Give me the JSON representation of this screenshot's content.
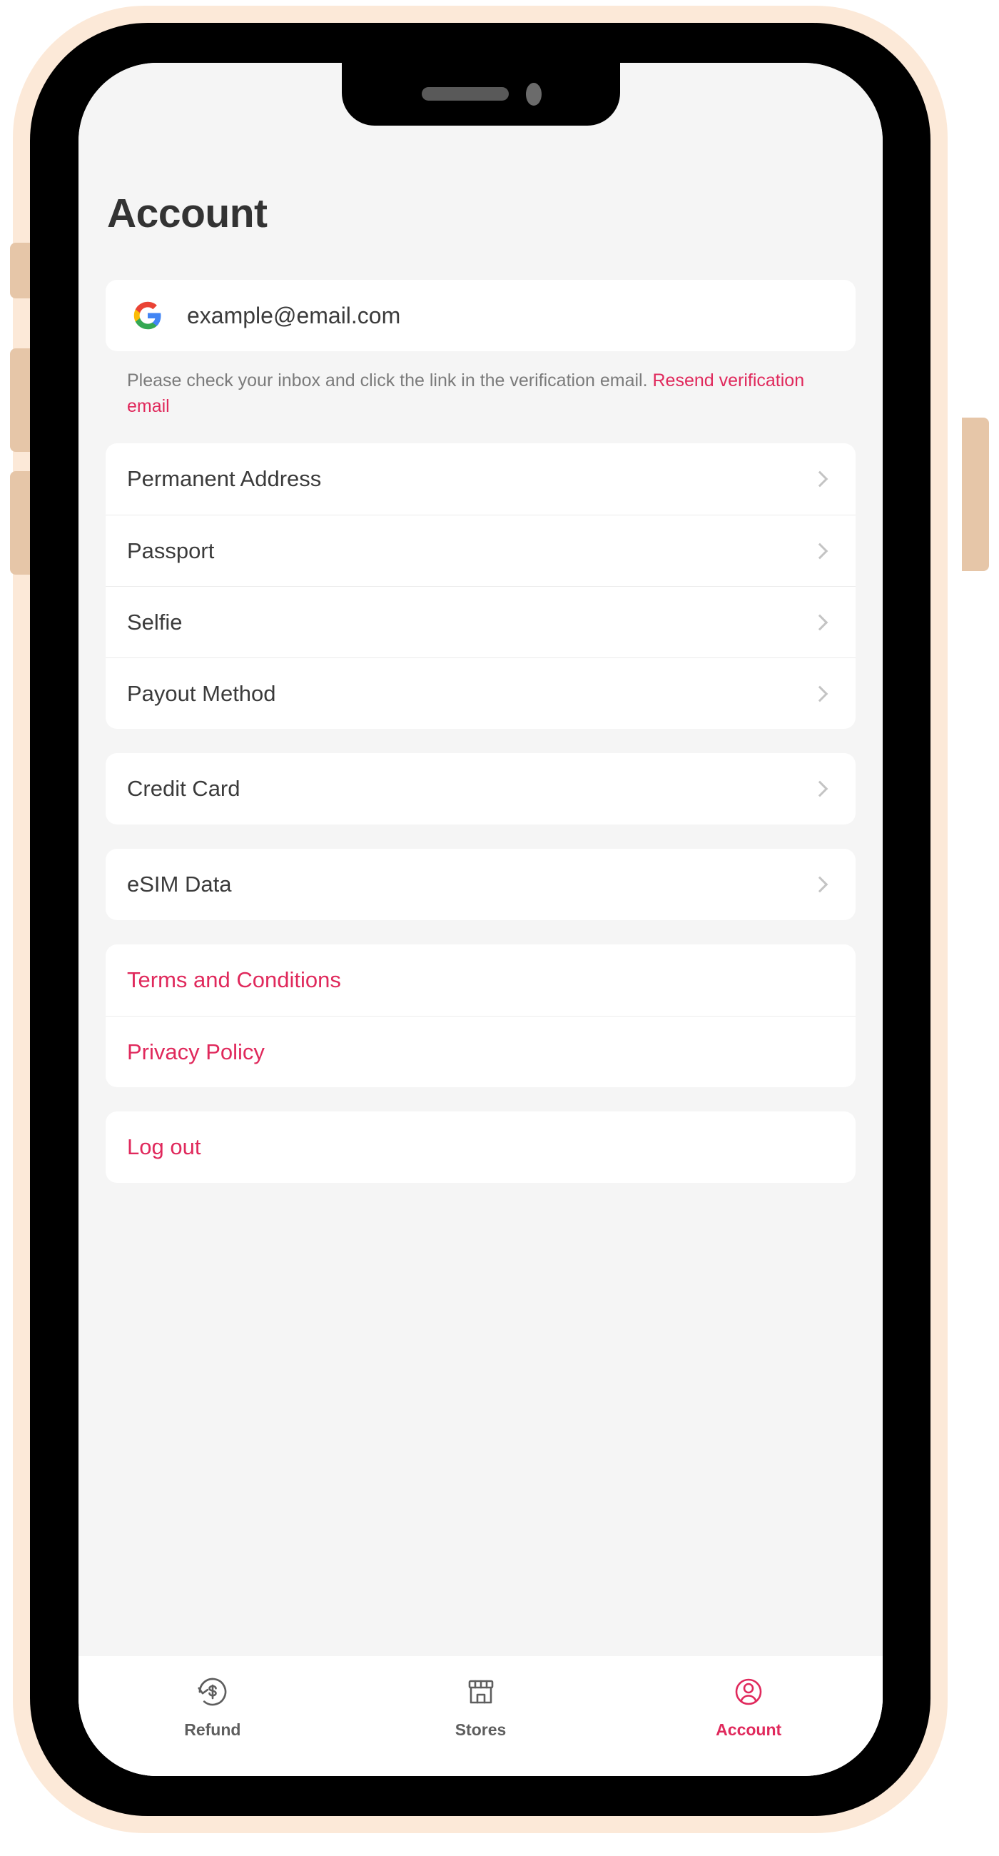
{
  "theme": {
    "accent": "#e0295c",
    "text_primary": "#3b3b3b",
    "text_muted": "#7b7b7b",
    "screen_bg": "#f5f5f5",
    "card_bg": "#ffffff",
    "frame_bezel": "#fce9d8",
    "frame_body": "#000000"
  },
  "screen": {
    "title": "Account",
    "account": {
      "provider_icon": "google-logo-icon",
      "email": "example@email.com",
      "verification_note_prefix": "Please check your inbox and click the link in the verification email. ",
      "verification_link": "Resend verification email"
    },
    "groups": [
      {
        "name": "identity",
        "items": [
          {
            "label": "Permanent Address",
            "accent": false,
            "chevron": true
          },
          {
            "label": "Passport",
            "accent": false,
            "chevron": true
          },
          {
            "label": "Selfie",
            "accent": false,
            "chevron": true
          },
          {
            "label": "Payout Method",
            "accent": false,
            "chevron": true
          }
        ]
      },
      {
        "name": "payment",
        "items": [
          {
            "label": "Credit Card",
            "accent": false,
            "chevron": true
          }
        ]
      },
      {
        "name": "connectivity",
        "items": [
          {
            "label": "eSIM Data",
            "accent": false,
            "chevron": true
          }
        ]
      },
      {
        "name": "legal",
        "items": [
          {
            "label": "Terms and Conditions",
            "accent": true,
            "chevron": false
          },
          {
            "label": "Privacy Policy",
            "accent": true,
            "chevron": false
          }
        ]
      },
      {
        "name": "session",
        "items": [
          {
            "label": "Log out",
            "accent": true,
            "chevron": false
          }
        ]
      }
    ],
    "tabbar": [
      {
        "label": "Refund",
        "icon": "refund-dollar-icon",
        "active": false
      },
      {
        "label": "Stores",
        "icon": "storefront-icon",
        "active": false
      },
      {
        "label": "Account",
        "icon": "user-circle-icon",
        "active": true
      }
    ]
  }
}
